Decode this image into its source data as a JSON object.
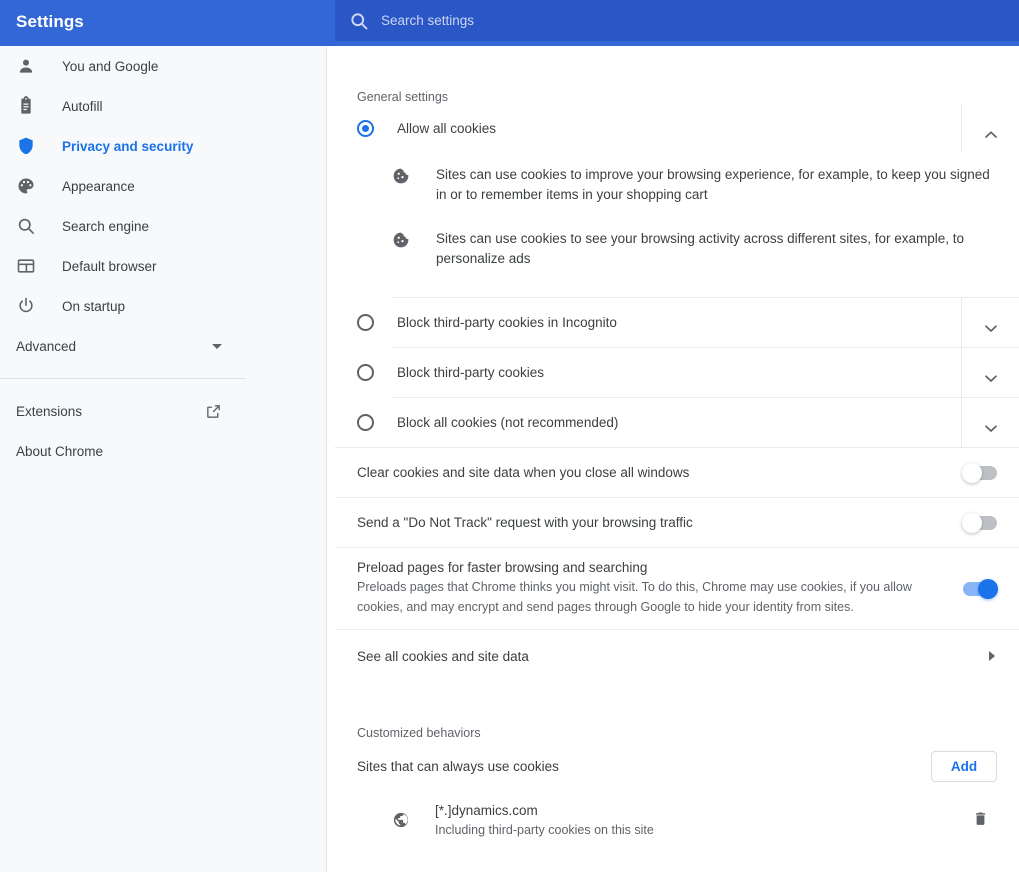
{
  "header": {
    "title": "Settings",
    "search_placeholder": "Search settings",
    "search_value": "",
    "search_icon": "search-icon",
    "bg_color": "#3367d6",
    "search_bg_color": "#2a56c6"
  },
  "sidebar": {
    "items": [
      {
        "label": "You and Google",
        "icon": "person-icon",
        "active": false
      },
      {
        "label": "Autofill",
        "icon": "clipboard-icon",
        "active": false
      },
      {
        "label": "Privacy and security",
        "icon": "shield-icon",
        "active": true
      },
      {
        "label": "Appearance",
        "icon": "palette-icon",
        "active": false
      },
      {
        "label": "Search engine",
        "icon": "search-icon",
        "active": false
      },
      {
        "label": "Default browser",
        "icon": "browser-window-icon",
        "active": false
      },
      {
        "label": "On startup",
        "icon": "power-icon",
        "active": false
      }
    ],
    "advanced": {
      "label": "Advanced",
      "icon": "caret-down-icon"
    },
    "extensions": {
      "label": "Extensions",
      "icon": "external-link-icon"
    },
    "about": {
      "label": "About Chrome"
    },
    "active_color": "#1a73e8"
  },
  "main": {
    "general_settings_title": "General settings",
    "cookie_options": [
      {
        "label": "Allow all cookies",
        "selected": true,
        "expanded": true,
        "chevron": "chevron-up-icon",
        "details": [
          {
            "icon": "cookie-icon",
            "text": "Sites can use cookies to improve your browsing experience, for example, to keep you signed in or to remember items in your shopping cart"
          },
          {
            "icon": "cookie-icon",
            "text": "Sites can use cookies to see your browsing activity across different sites, for example, to personalize ads"
          }
        ]
      },
      {
        "label": "Block third-party cookies in Incognito",
        "selected": false,
        "expanded": false,
        "chevron": "chevron-down-icon",
        "details": []
      },
      {
        "label": "Block third-party cookies",
        "selected": false,
        "expanded": false,
        "chevron": "chevron-down-icon",
        "details": []
      },
      {
        "label": "Block all cookies (not recommended)",
        "selected": false,
        "expanded": false,
        "chevron": "chevron-down-icon",
        "details": []
      }
    ],
    "toggles": [
      {
        "title": "Clear cookies and site data when you close all windows",
        "subtitle": "",
        "on": false
      },
      {
        "title": "Send a \"Do Not Track\" request with your browsing traffic",
        "subtitle": "",
        "on": false
      },
      {
        "title": "Preload pages for faster browsing and searching",
        "subtitle": "Preloads pages that Chrome thinks you might visit. To do this, Chrome may use cookies, if you allow cookies, and may encrypt and send pages through Google to hide your identity from sites.",
        "on": true
      }
    ],
    "see_all_cookies": {
      "label": "See all cookies and site data",
      "icon": "arrow-right-icon"
    },
    "customized_behaviors_title": "Customized behaviors",
    "sites_always_use_cookies": {
      "label": "Sites that can always use cookies",
      "add_label": "Add",
      "entries": [
        {
          "icon": "globe-icon",
          "name": "[*.]dynamics.com",
          "subtitle": "Including third-party cookies on this site",
          "delete_icon": "trash-icon"
        }
      ]
    }
  }
}
